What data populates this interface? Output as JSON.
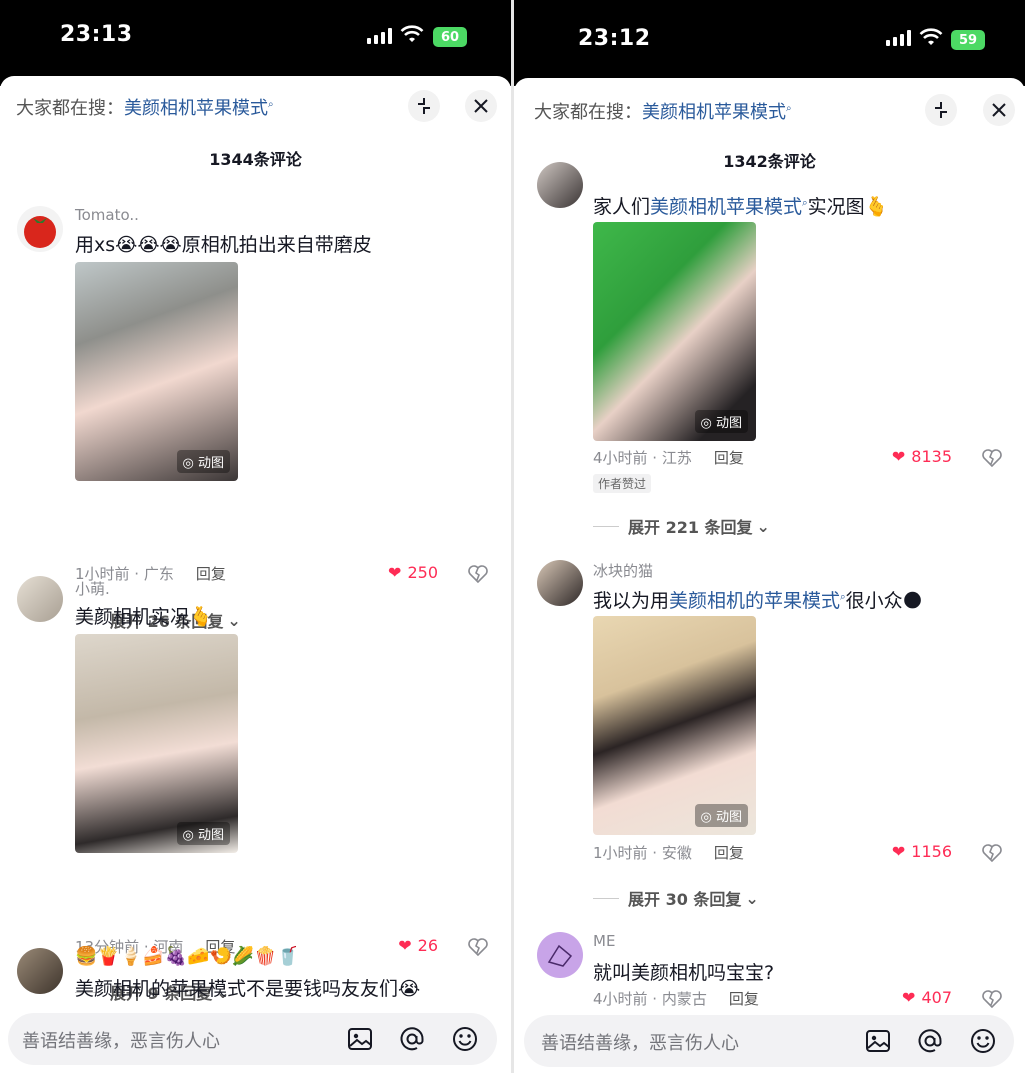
{
  "input_placeholder": "善语结善缘，恶言伤人心",
  "search_hint_prefix": "大家都在搜：",
  "search_keyword": "美颜相机苹果模式",
  "reply_label": "回复",
  "left": {
    "time": "23:13",
    "battery": "60",
    "comment_count": "1344条评论",
    "comments": [
      {
        "username": "Tomato..",
        "text_prefix": "用xs",
        "text_emoji": "😭😭😭",
        "text_suffix": "原相机拍出来自带磨皮",
        "photo_tag": "动图",
        "meta": "1小时前 · 广东",
        "likes": "250",
        "expand": "展开 26 条回复"
      },
      {
        "username": "小萌.",
        "text_prefix": "美颜相机实况",
        "text_emoji": "🫰",
        "photo_tag": "动图",
        "meta": "13分钟前 · 河南",
        "likes": "26",
        "expand": "展开 9 条回复"
      },
      {
        "emoji_line": "🍔🍟🍦🍰🍇🧀🍤🌽🍿🥤",
        "text_prefix": "美颜相机的苹果模式不是要钱吗友友们",
        "text_emoji": "😭"
      }
    ]
  },
  "right": {
    "time": "23:12",
    "battery": "59",
    "comment_count": "1342条评论",
    "comments": [
      {
        "text_prefix": "家人们",
        "text_keyword": "美颜相机苹果模式",
        "text_suffix": "实况图",
        "text_emoji": "🫰",
        "photo_tag": "动图",
        "meta": "4小时前 · 江苏",
        "likes": "8135",
        "badge": "作者赞过",
        "expand": "展开 221 条回复"
      },
      {
        "username": "冰块的猫",
        "text_prefix": "我以为用",
        "text_keyword": "美颜相机的苹果模式",
        "text_suffix": "很小众",
        "text_emoji": "🌑",
        "photo_tag": "动图",
        "meta": "1小时前 · 安徽",
        "likes": "1156",
        "expand": "展开 30 条回复"
      },
      {
        "username": "ME",
        "text_prefix": "就叫美颜相机吗宝宝?",
        "meta": "4小时前 · 内蒙古",
        "likes": "407"
      }
    ]
  }
}
